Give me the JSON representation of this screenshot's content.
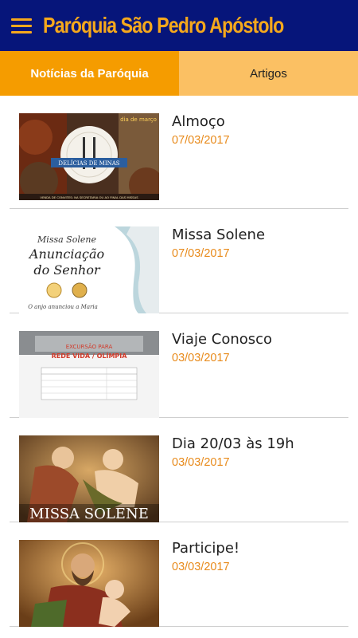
{
  "header": {
    "title": "Paróquia São Pedro Apóstolo",
    "menu_icon": "hamburger-menu-icon"
  },
  "tabs": [
    {
      "label": "Notícias da Paróquia",
      "active": true
    },
    {
      "label": "Artigos",
      "active": false
    }
  ],
  "colors": {
    "appbar": "#06157a",
    "accent": "#f5a81c",
    "tab_active": "#f59c00",
    "tab_inactive": "#fbc063",
    "date": "#e88a1a"
  },
  "news": [
    {
      "title": "Almoço",
      "date": "07/03/2017",
      "thumb": {
        "banner": "DELÍCIAS DE MINAS",
        "top_text": "dia de março",
        "bottom_text": "VENDA DE CONVITES: NA SECRETARIA OU AO FINAL DAS MISSAS"
      }
    },
    {
      "title": "Missa Solene",
      "date": "07/03/2017",
      "thumb": {
        "line1": "Missa Solene",
        "line2": "Anunciação",
        "line3": "do Senhor",
        "caption": "O anjo anunciou a Maria"
      }
    },
    {
      "title": "Viaje Conosco",
      "date": "03/03/2017",
      "thumb": {
        "line1": "EXCURSÃO PARA",
        "line2": "REDE VIDA / OLÍMPIA"
      }
    },
    {
      "title": "Dia 20/03 às 19h",
      "date": "03/03/2017",
      "thumb": {
        "caption": "MISSA SOLENE"
      }
    },
    {
      "title": "Participe!",
      "date": "03/03/2017",
      "thumb": {}
    }
  ]
}
